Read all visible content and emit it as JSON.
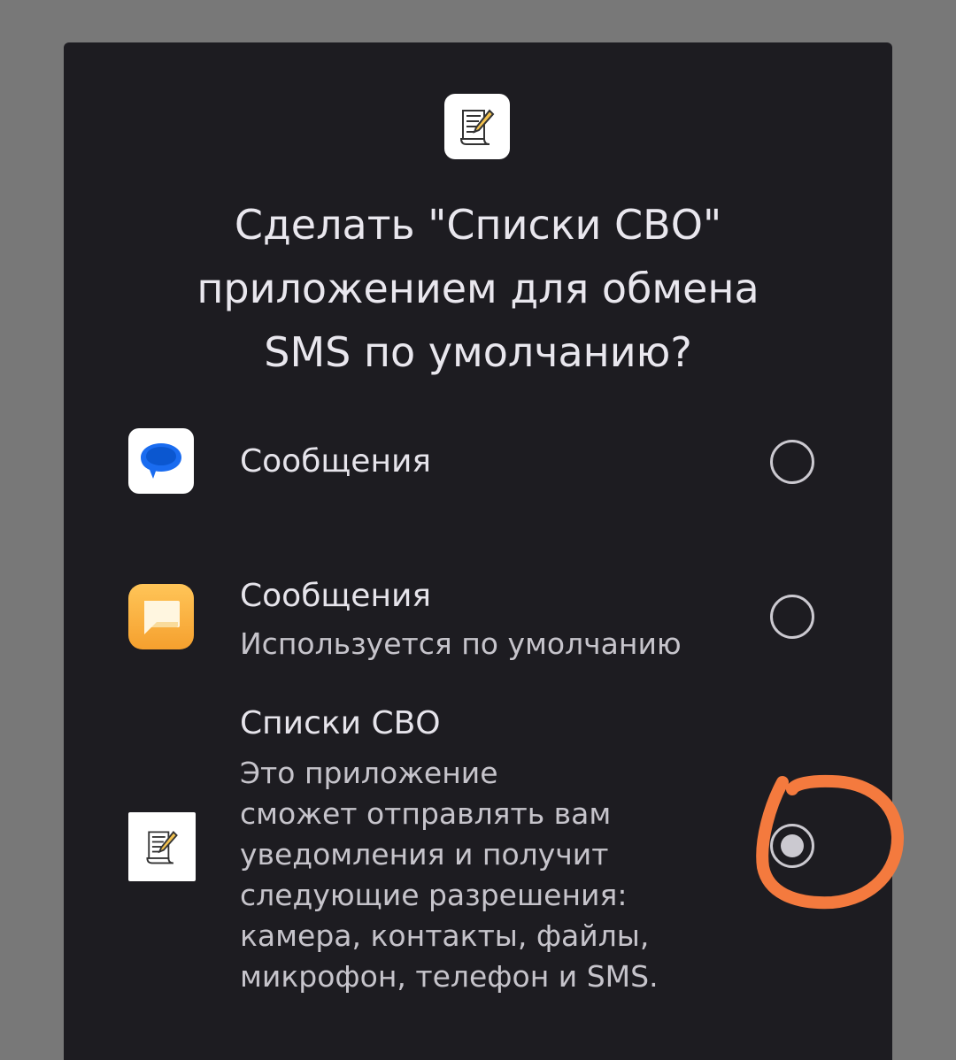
{
  "dialog": {
    "title_lines": [
      "Сделать \"Списки СВО\"",
      "приложением для обмена",
      "SMS по умолчанию?"
    ],
    "header_icon": "notepad-pen-icon"
  },
  "options": [
    {
      "label": "Сообщения",
      "icon": "google-messages-icon",
      "checked": false
    },
    {
      "label": "Сообщения",
      "subtitle": "Используется по умолчанию",
      "icon": "xiaomi-messages-icon",
      "checked": false
    },
    {
      "label": "Списки СВО",
      "description_lines": [
        "Это приложение",
        "сможет отправлять вам",
        "уведомления и получит",
        "следующие разрешения:",
        "камера, контакты, файлы,",
        "микрофон, телефон и SMS."
      ],
      "icon": "notepad-pen-icon",
      "checked": true
    }
  ],
  "colors": {
    "scrim": "#787878",
    "dialog_bg": "#1d1c21",
    "primary_text": "#e6e4eb",
    "secondary_text": "#c6c4cb",
    "google_blue": "#1a6cf0",
    "xiaomi_orange": "#f5a02e",
    "annotation_orange": "#f47a3e"
  }
}
